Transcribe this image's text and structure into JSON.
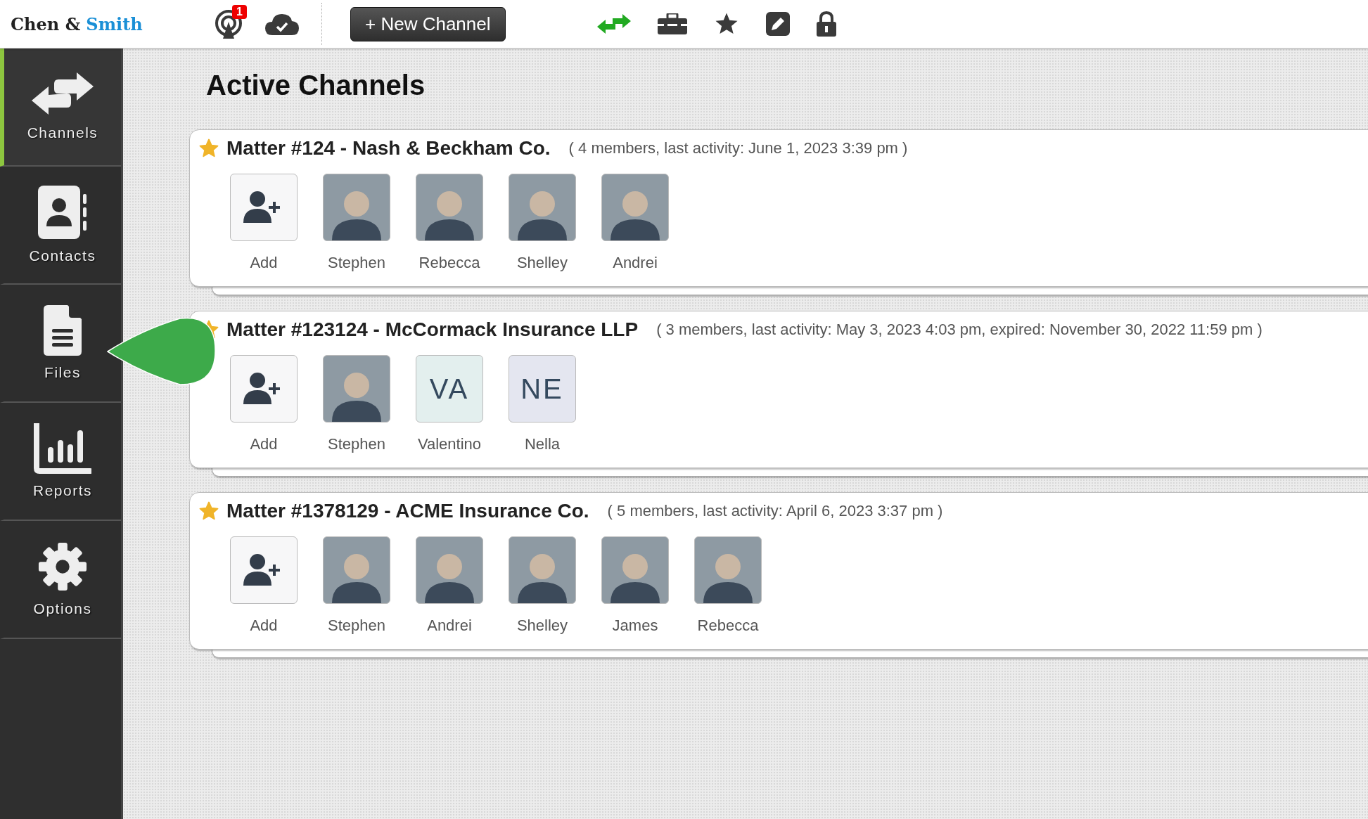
{
  "brand": {
    "part_1": "Chen &",
    "part_2": "Smith"
  },
  "toolbar": {
    "notification_count": "1",
    "new_channel_button": "+ New Channel"
  },
  "sidebar": {
    "items": [
      {
        "label": "Channels",
        "kind": "arrows",
        "selected": true
      },
      {
        "label": "Contacts",
        "kind": "contacts",
        "selected": false
      },
      {
        "label": "Files",
        "kind": "file",
        "selected": false
      },
      {
        "label": "Reports",
        "kind": "chart",
        "selected": false
      },
      {
        "label": "Options",
        "kind": "gear",
        "selected": false
      }
    ]
  },
  "page_title": "Active Channels",
  "channels": [
    {
      "title": "Matter #124 - Nash & Beckham Co.",
      "details": "( 4 members, last activity: June 1, 2023 3:39 pm )",
      "starred": true,
      "members": [
        {
          "kind": "add",
          "name": "Add"
        },
        {
          "kind": "photo",
          "name": "Stephen"
        },
        {
          "kind": "photo",
          "name": "Rebecca"
        },
        {
          "kind": "photo",
          "name": "Shelley"
        },
        {
          "kind": "photo",
          "name": "Andrei"
        }
      ]
    },
    {
      "title": "Matter #123124 - McCormack Insurance LLP",
      "details": "( 3 members, last activity: May 3, 2023 4:03 pm, expired: November 30, 2022 11:59 pm )",
      "starred": true,
      "members": [
        {
          "kind": "add",
          "name": "Add"
        },
        {
          "kind": "photo",
          "name": "Stephen"
        },
        {
          "kind": "initials",
          "initials": "VA",
          "color": "#e3efee",
          "name": "Valentino"
        },
        {
          "kind": "initials",
          "initials": "NE",
          "color": "#e4e6f0",
          "name": "Nella"
        }
      ]
    },
    {
      "title": "Matter #1378129 - ACME Insurance Co.",
      "details": "( 5 members, last activity: April 6, 2023 3:37 pm )",
      "starred": true,
      "members": [
        {
          "kind": "add",
          "name": "Add"
        },
        {
          "kind": "photo",
          "name": "Stephen"
        },
        {
          "kind": "photo",
          "name": "Andrei"
        },
        {
          "kind": "photo",
          "name": "Shelley"
        },
        {
          "kind": "photo",
          "name": "James"
        },
        {
          "kind": "photo",
          "name": "Rebecca"
        }
      ]
    }
  ]
}
